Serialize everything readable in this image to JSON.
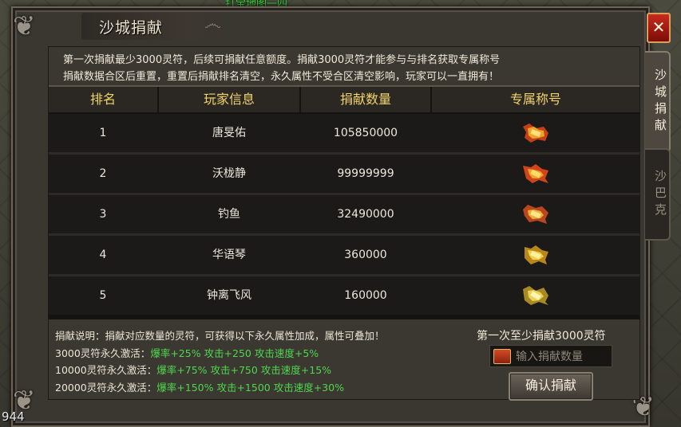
{
  "world": {
    "top_text": "打宝地图一四",
    "fps": "944"
  },
  "panel": {
    "title": "沙城捐献",
    "close_label": "✕",
    "tabs": [
      {
        "label": "沙城捐献",
        "active": true
      },
      {
        "label": "沙巴克",
        "active": false
      }
    ],
    "notice": [
      "第一次捐献最少3000灵符，后续可捐献任意额度。捐献3000灵符才能参与与排名获取专属称号",
      "捐献数据合区后重置，重置后捐献排名清空，永久属性不受合区清空影响，玩家可以一直拥有！"
    ],
    "table": {
      "headers": [
        "排名",
        "玩家信息",
        "捐献数量",
        "专属称号"
      ],
      "rows": [
        {
          "rank": "1",
          "player": "唐旻佑",
          "amount": "105850000",
          "title_icon": "flame-title-badge-icon"
        },
        {
          "rank": "2",
          "player": "沃栊静",
          "amount": "99999999",
          "title_icon": "flame-title-badge-icon"
        },
        {
          "rank": "3",
          "player": "钓鱼",
          "amount": "32490000",
          "title_icon": "flame-title-badge-icon"
        },
        {
          "rank": "4",
          "player": "华语琴",
          "amount": "360000",
          "title_icon": "gold-title-badge-icon"
        },
        {
          "rank": "5",
          "player": "钟离飞风",
          "amount": "160000",
          "title_icon": "gold-title-badge-icon"
        }
      ]
    },
    "description": {
      "intro": "捐献说明：捐献对应数量的灵符，可获得以下永久属性加成，属性可叠加！",
      "tiers": [
        {
          "label": "3000灵符永久激活：",
          "effect": "爆率+25% 攻击+250 攻击速度+5%"
        },
        {
          "label": "10000灵符永久激活：",
          "effect": "爆率+75% 攻击+750 攻击速度+15%"
        },
        {
          "label": "20000灵符永久激活：",
          "effect": "爆率+150% 攻击+1500 攻击速度+30%"
        }
      ]
    },
    "donate": {
      "requirement": "第一次至少捐献3000灵符",
      "input_placeholder": "输入捐献数量",
      "input_value": "",
      "confirm_label": "确认捐献"
    },
    "colors": {
      "header_gold": "#f1d36a",
      "effect_green": "#4fd64f",
      "close_red": "#c82a20"
    }
  }
}
